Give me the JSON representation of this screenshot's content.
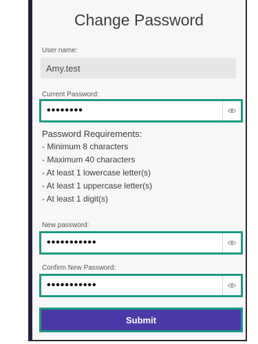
{
  "form": {
    "title": "Change Password",
    "username_label": "User name:",
    "username_value": "Amy.test",
    "current_password_label": "Current Password:",
    "current_password_value": "••••••••",
    "requirements_heading": "Password Requirements:",
    "requirements": [
      "- Minimum 8 characters",
      "- Maximum 40 characters",
      "- At least 1 lowercase letter(s)",
      "- At least 1 uppercase letter(s)",
      "- At least 1 digit(s)"
    ],
    "new_password_label": "New password:",
    "new_password_value": "•••••••••••",
    "confirm_password_label": "Confirm New Password:",
    "confirm_password_value": "•••••••••••",
    "submit_label": "Submit"
  },
  "icons": {
    "show_password": "eye-icon"
  },
  "colors": {
    "highlight": "#1e9a82",
    "submit": "#4a3aa7",
    "panel_edge": "#23253e"
  }
}
